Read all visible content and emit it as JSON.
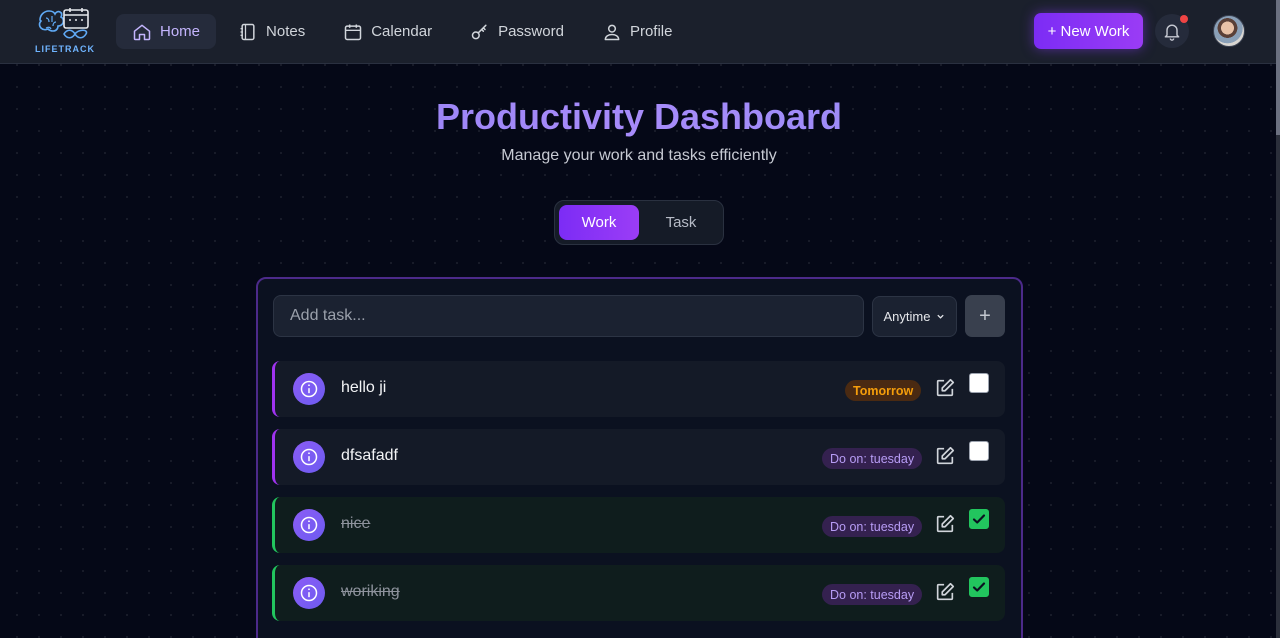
{
  "brand": {
    "logo_text": "LIFETRACK"
  },
  "nav": {
    "items": [
      {
        "label": "Home",
        "icon": "home-icon",
        "active": true
      },
      {
        "label": "Notes",
        "icon": "notebook-icon",
        "active": false
      },
      {
        "label": "Calendar",
        "icon": "calendar-icon",
        "active": false
      },
      {
        "label": "Password",
        "icon": "key-icon",
        "active": false
      },
      {
        "label": "Profile",
        "icon": "user-icon",
        "active": false
      }
    ]
  },
  "header_actions": {
    "new_work_label": "+ New Work",
    "notification_icon": "bell-icon",
    "has_unread": true
  },
  "hero": {
    "title": "Productivity Dashboard",
    "subtitle": "Manage your work and tasks efficiently"
  },
  "toggle": {
    "work_label": "Work",
    "task_label": "Task",
    "selected": "Work"
  },
  "composer": {
    "placeholder": "Add task...",
    "timing_value": "Anytime",
    "add_label": "+"
  },
  "tasks": [
    {
      "title": "hello ji",
      "badge": "Tomorrow",
      "completed": false
    },
    {
      "title": "dfsafadf",
      "badge": "Do on: tuesday",
      "completed": false
    },
    {
      "title": "nice",
      "badge": "Do on: tuesday",
      "completed": true
    },
    {
      "title": "woriking",
      "badge": "Do on: tuesday",
      "completed": true
    }
  ],
  "colors": {
    "accent": "#7c2cf5",
    "pending": "#a033f0",
    "done": "#22c55e",
    "background": "#050817"
  }
}
